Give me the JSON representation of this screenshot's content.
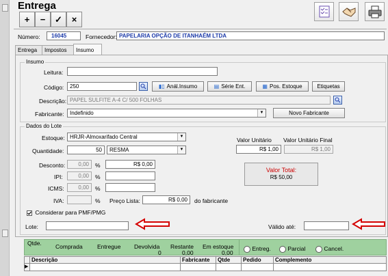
{
  "window": {
    "title": "Entrega"
  },
  "toolbar": {
    "add": "+",
    "remove": "−",
    "confirm": "✓",
    "cancel": "×"
  },
  "header": {
    "numero_label": "Número:",
    "numero_value": "16045",
    "fornecedor_label": "Fornecedor:",
    "fornecedor_value": "PAPELARIA OPÇÃO DE ITANHAÉM LTDA"
  },
  "tabs": [
    "Entrega",
    "Impostos",
    "Insumo"
  ],
  "insumo": {
    "legend": "Insumo",
    "leitura_label": "Leitura:",
    "leitura_value": "",
    "codigo_label": "Código:",
    "codigo_value": "250",
    "anal_insumo": "Anál.Insumo",
    "serie_ent": "Série Ent.",
    "pos_estoque": "Pos. Estoque",
    "etiquetas": "Etiquetas",
    "descricao_label": "Descrição:",
    "descricao_value": "PAPEL SULFITE  A-4 C/ 500 FOLHAS",
    "fabricante_label": "Fabricante:",
    "fabricante_value": "Indefinido",
    "novo_fabricante": "Novo Fabricante"
  },
  "lote": {
    "legend": "Dados do Lote",
    "estoque_label": "Estoque:",
    "estoque_value": "HRJR-Almoxarifado Central",
    "quantidade_label": "Quantidade:",
    "quantidade_value": "50",
    "unidade_value": "RESMA",
    "desconto_label": "Desconto:",
    "desconto_pct": "0,00",
    "desconto_valor": "R$ 0,00",
    "ipi_label": "IPI:",
    "ipi_pct": "0,00",
    "icms_label": "ICMS:",
    "icms_pct": "0,00",
    "iva_label": "IVA:",
    "pct": "%",
    "preco_lista_label": "Preço Lista:",
    "preco_lista_value": "R$ 0,00",
    "do_fabricante": "do fabricante",
    "valor_unitario_label": "Valor Unitário",
    "valor_unitario_value": "R$ 1,00",
    "valor_unitario_final_label": "Valor Unitário Final",
    "valor_unitario_final_value": "R$ 1,00",
    "valor_total_label": "Valor Total:",
    "valor_total_value": "R$ 50,00",
    "considerar_label": "Considerar para PMF/PMG",
    "lote_label": "Lote:",
    "lote_value": "",
    "valido_label": "Válido até:",
    "valido_value": ""
  },
  "summary": {
    "qtde_label": "Qtde.",
    "comprada_label": "Comprada",
    "entregue_label": "Entregue",
    "devolvida_label": "Devolvida",
    "devolvida_value": "0",
    "restante_label": "Restante",
    "restante_value": "0,00",
    "em_estoque_label": "Em estoque",
    "em_estoque_value": "0,00",
    "radio_entreg": "Entreg.",
    "radio_parcial": "Parcial",
    "radio_cancel": "Cancel."
  },
  "grid": {
    "columns": [
      "Descrição",
      "Fabricante",
      "Qtde",
      "Pedido",
      "Complemento"
    ],
    "row_indicator": "▶"
  },
  "colors": {
    "arrow_red": "#d40000",
    "green_bar": "#9fd19f",
    "total_red": "#cc0000"
  }
}
